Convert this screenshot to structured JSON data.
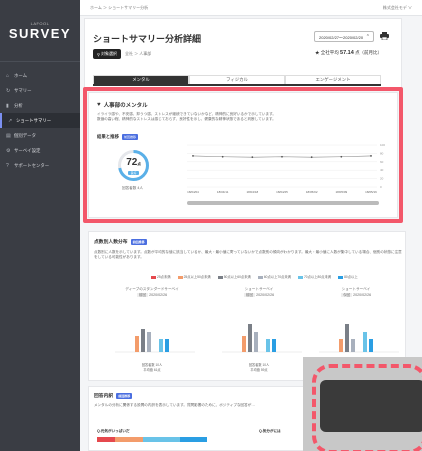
{
  "sidebar": {
    "brand": "LAFOOL",
    "product": "SURVEY",
    "items": [
      {
        "label": "ホーム",
        "icon": "home-icon",
        "glyph": "⌂"
      },
      {
        "label": "サマリー",
        "icon": "refresh-icon",
        "glyph": "↻"
      },
      {
        "label": "分析",
        "icon": "bar-chart-icon",
        "glyph": "▮"
      },
      {
        "label": "ショートサマリー",
        "icon": "line-chart-icon",
        "glyph": "↗"
      },
      {
        "label": "個別データ",
        "icon": "document-icon",
        "glyph": "▤"
      },
      {
        "label": "サーベイ設定",
        "icon": "gear-icon",
        "glyph": "⚙"
      },
      {
        "label": "サポートセンター",
        "icon": "question-icon",
        "glyph": "?"
      }
    ]
  },
  "topbar": {
    "breadcrumb": "ホーム ＞ ショートサマリー分析",
    "company": "株式会社モデ ∨"
  },
  "header": {
    "title": "ショートサマリー分析詳細",
    "date_range": "2020/02/27〜2020/02/20",
    "date_arrow": "⌃",
    "select_button": "対象選択",
    "crumb": "全社 ＞ 人事部",
    "score_label": "全社平均",
    "score_value": "57.14",
    "score_suffix": "点（前月比）"
  },
  "tabs": [
    "メンタル",
    "フィジカル",
    "エンゲージメント"
  ],
  "mental": {
    "title": "人事部のメンタル",
    "desc1": "イライラ感や、不安感、抑うつ感、ストレスが継続できていないかなど、精神的に良好いるかで示しています。",
    "desc2": "数値の高い程、精神的なストレスは感じておらず、良好性を示し、健康的な精神状態であると判断しています。",
    "trend_label": "結果と推移",
    "trend_badge": "前回推移",
    "score": "72",
    "score_unit": "点",
    "score_badge": "良好",
    "answer_count": "回答者数 4人",
    "chart_xlabels": [
      "18/04/04",
      "18/04/11",
      "18/04/18",
      "18/04/25",
      "18/05/02",
      "18/05/09",
      "18/05/16"
    ],
    "chart_ylabels": [
      "100",
      "80",
      "60",
      "40",
      "20",
      "0"
    ]
  },
  "chart_data": {
    "type": "line",
    "x": [
      "18/04/04",
      "18/04/11",
      "18/04/18",
      "18/04/25",
      "18/05/02",
      "18/05/09",
      "18/05/16"
    ],
    "series": [
      {
        "values": [
          74,
          72,
          71,
          72,
          71,
          72,
          74
        ]
      }
    ],
    "ylim": [
      0,
      100
    ]
  },
  "distribution": {
    "title": "点数別人数分布",
    "badge": "前回推移",
    "desc": "点数別に人数を示しています。点数が平均的な値に該当しているか、最大・最小値に寄っていないかで点数別の傾向がわかります。最大・最小値に人数が集中している場合、個別の状態に注意をしている可能性があります。",
    "legend": [
      "25点未満",
      "25点以上50点未満",
      "50点以上60点未満",
      "60点以上70点未満",
      "70点以上80点未満",
      "80点以上"
    ],
    "legend_colors": [
      "#e5484d",
      "#f39c6b",
      "#7a7f87",
      "#a8b0bd",
      "#69c3e8",
      "#2a9ee3"
    ],
    "groups": [
      {
        "title": "ディーブのスタンダードサーベイ",
        "date": "2020/02/26",
        "tag": "前回"
      },
      {
        "title": "ショートサーベイ",
        "date": "2020/02/26",
        "tag": "前回"
      },
      {
        "title": "ショートサーベイ",
        "date": "2020/02/26",
        "tag": "今回"
      }
    ],
    "notes": [
      [
        "回答者数 10人",
        "平均値 61点"
      ],
      [
        "回答者数 10人",
        "平均値 59点"
      ],
      [
        "",
        ""
      ]
    ]
  },
  "answers": {
    "title": "回答内訳",
    "badge": "前回推移",
    "desc": "メンタルの分析に関係する設問の内訳を表示しています。質問影響のために、ポジティブな回答が…",
    "q1": "Q.元気がいっぱいだ",
    "q2": "Q.気分がには"
  }
}
